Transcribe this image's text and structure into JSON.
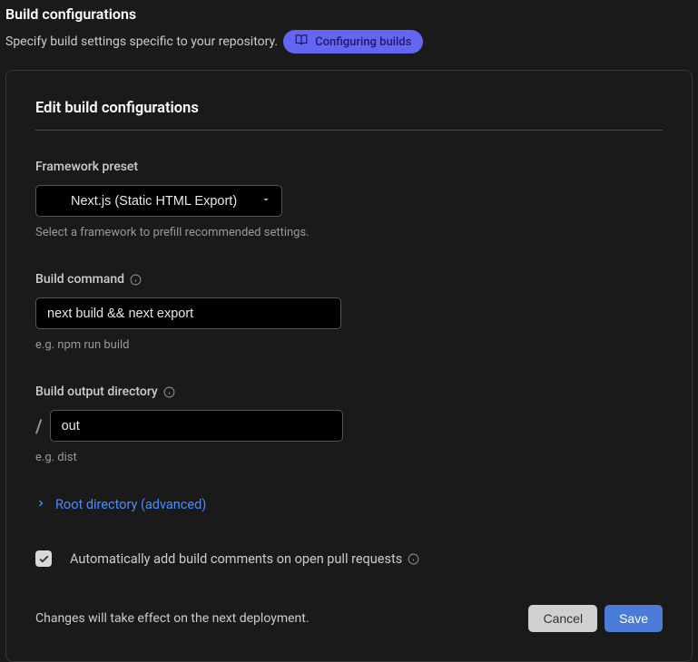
{
  "page": {
    "title": "Build configurations",
    "subtitle": "Specify build settings specific to your repository.",
    "docs_link": "Configuring builds"
  },
  "card": {
    "title": "Edit build configurations",
    "framework": {
      "label": "Framework preset",
      "value": "Next.js (Static HTML Export)",
      "hint": "Select a framework to prefill recommended settings."
    },
    "build_command": {
      "label": "Build command",
      "value": "next build && next export",
      "hint": "e.g. npm run build"
    },
    "output_dir": {
      "label": "Build output directory",
      "prefix": "/",
      "value": "out",
      "hint": "e.g. dist"
    },
    "advanced": {
      "label": "Root directory (advanced)"
    },
    "auto_comments": {
      "label": "Automatically add build comments on open pull requests",
      "checked": true
    },
    "footer": {
      "note": "Changes will take effect on the next deployment.",
      "cancel": "Cancel",
      "save": "Save"
    }
  }
}
